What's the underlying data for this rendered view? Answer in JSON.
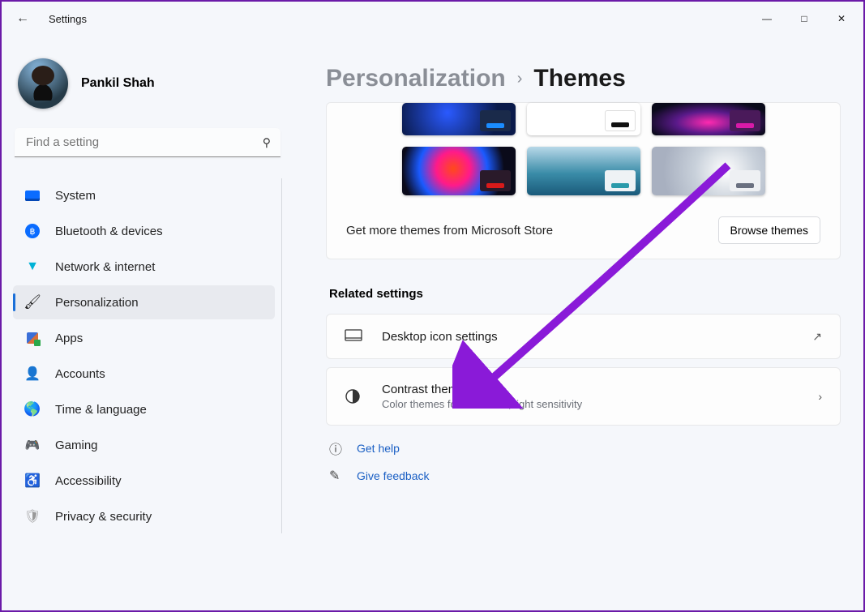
{
  "window": {
    "title": "Settings"
  },
  "profile": {
    "name": "Pankil Shah"
  },
  "search": {
    "placeholder": "Find a setting"
  },
  "nav": {
    "items": [
      {
        "label": "System"
      },
      {
        "label": "Bluetooth & devices"
      },
      {
        "label": "Network & internet"
      },
      {
        "label": "Personalization"
      },
      {
        "label": "Apps"
      },
      {
        "label": "Accounts"
      },
      {
        "label": "Time & language"
      },
      {
        "label": "Gaming"
      },
      {
        "label": "Accessibility"
      },
      {
        "label": "Privacy & security"
      }
    ]
  },
  "breadcrumb": {
    "parent": "Personalization",
    "current": "Themes"
  },
  "themes": {
    "store_text": "Get more themes from Microsoft Store",
    "browse_label": "Browse themes"
  },
  "related": {
    "heading": "Related settings",
    "desktop_icons": {
      "label": "Desktop icon settings"
    },
    "contrast": {
      "label": "Contrast themes",
      "sub": "Color themes for low vision, light sensitivity"
    }
  },
  "help": {
    "get_help": "Get help",
    "feedback": "Give feedback"
  }
}
